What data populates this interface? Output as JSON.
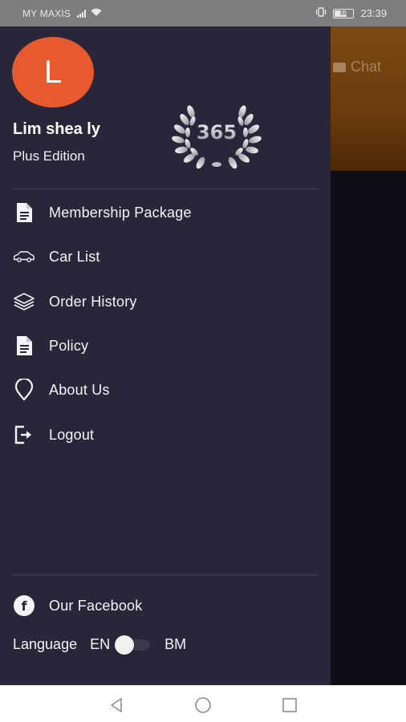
{
  "status_bar": {
    "carrier": "MY MAXIS",
    "battery": "86",
    "time": "23:39"
  },
  "background": {
    "chat_label": "Chat"
  },
  "drawer": {
    "avatar_initial": "L",
    "user_name": "Lim shea ly",
    "edition": "Plus Edition",
    "badge_text": "365",
    "menu": [
      {
        "label": "Membership Package",
        "icon": "document-icon"
      },
      {
        "label": "Car List",
        "icon": "car-icon"
      },
      {
        "label": "Order History",
        "icon": "layers-icon"
      },
      {
        "label": "Policy",
        "icon": "document-icon"
      },
      {
        "label": "About Us",
        "icon": "location-pin-icon"
      },
      {
        "label": "Logout",
        "icon": "logout-icon"
      }
    ],
    "facebook_label": "Our Facebook",
    "language": {
      "label": "Language",
      "option_left": "EN",
      "option_right": "BM",
      "selected": "EN"
    }
  },
  "colors": {
    "drawer_bg": "#292639",
    "avatar": "#e85a2e",
    "accent_header": "#7b4a14"
  }
}
